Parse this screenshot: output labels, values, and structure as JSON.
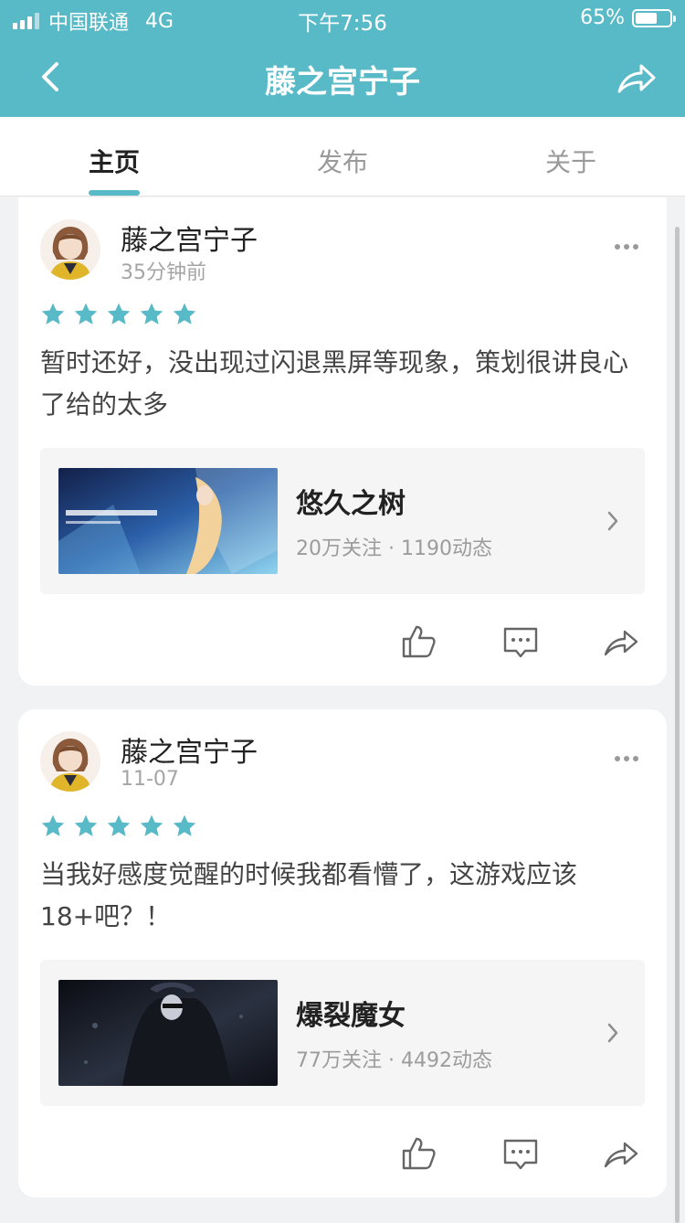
{
  "status_bar": {
    "carrier": "中国联通",
    "network": "4G",
    "time": "下午7:56",
    "battery": "65%",
    "battery_level": 0.65
  },
  "nav": {
    "title": "藤之宫宁子",
    "back_icon": "back-arrow-icon",
    "share_icon": "share-icon"
  },
  "tabs": [
    {
      "label": "主页"
    },
    {
      "label": "发布"
    },
    {
      "label": "关于"
    }
  ],
  "colors": {
    "accent": "#58b9c7",
    "star": "#58b9c7"
  },
  "posts": [
    {
      "user": "藤之宫宁子",
      "time": "35分钟前",
      "rating": 5,
      "text": "暂时还好，没出现过闪退黑屏等现象，策划很讲良心了给的太多",
      "game": {
        "name": "悠久之树",
        "followers": "20万关注",
        "posts": "1190动态",
        "stats": "20万关注 · 1190动态"
      }
    },
    {
      "user": "藤之宫宁子",
      "time": "11-07",
      "rating": 5,
      "text": "当我好感度觉醒的时候我都看懵了，这游戏应该18+吧？！",
      "game": {
        "name": "爆裂魔女",
        "followers": "77万关注",
        "posts": "4492动态",
        "stats": "77万关注 · 4492动态"
      }
    }
  ]
}
